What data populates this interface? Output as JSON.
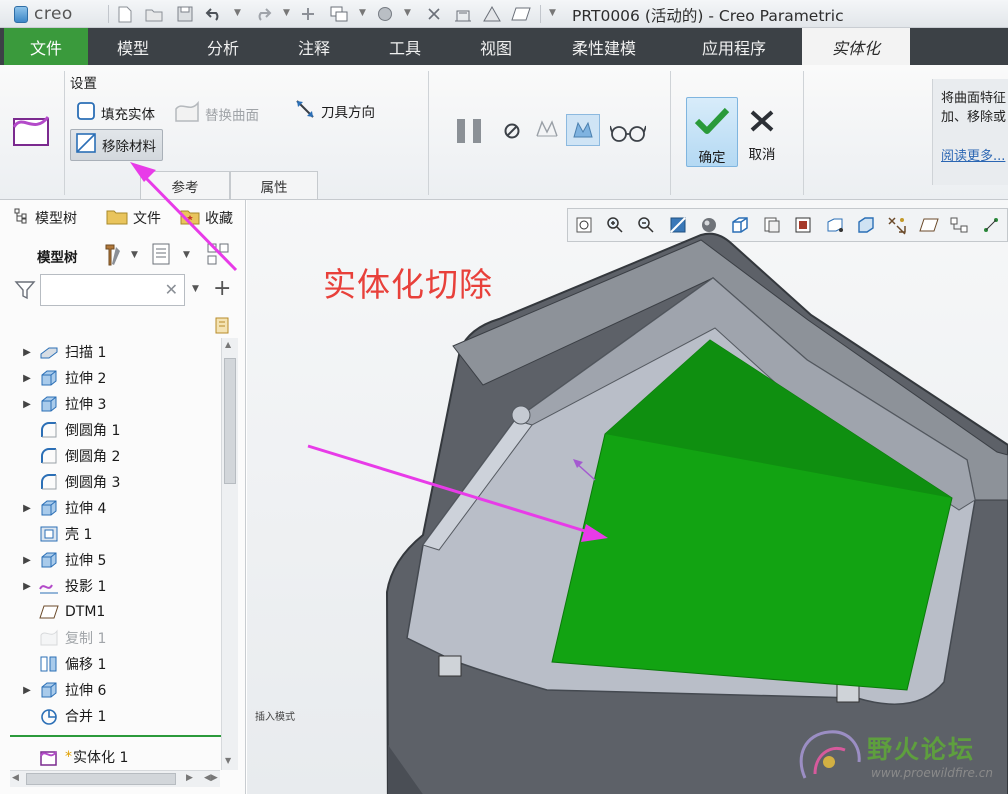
{
  "app": {
    "logo_text": "creo",
    "window_title": "PRT0006 (活动的) - Creo Parametric"
  },
  "tabs": [
    "文件",
    "模型",
    "分析",
    "注释",
    "工具",
    "视图",
    "柔性建模",
    "应用程序",
    "实体化"
  ],
  "active_tab": "实体化",
  "ribbon": {
    "settings_label": "设置",
    "fill_solid": "填充实体",
    "replace_surface": "替换曲面",
    "tool_direction": "刀具方向",
    "remove_material": "移除材料",
    "subtabs": [
      "参考",
      "属性"
    ],
    "ok": "确定",
    "cancel": "取消",
    "hint_line1": "将曲面特征",
    "hint_line2": "加、移除或",
    "hint_link": "阅读更多..."
  },
  "panel": {
    "tabs": [
      "模型树",
      "文件",
      "收藏"
    ],
    "tree_label": "模型树",
    "filter_placeholder": "",
    "items": [
      {
        "label": "扫描 1",
        "icon": "sweep-icon",
        "expandable": true,
        "dim": false
      },
      {
        "label": "拉伸 2",
        "icon": "extrude-icon",
        "expandable": true,
        "dim": false
      },
      {
        "label": "拉伸 3",
        "icon": "extrude-icon",
        "expandable": true,
        "dim": false
      },
      {
        "label": "倒圆角 1",
        "icon": "round-icon",
        "expandable": false,
        "dim": false
      },
      {
        "label": "倒圆角 2",
        "icon": "round-icon",
        "expandable": false,
        "dim": false
      },
      {
        "label": "倒圆角 3",
        "icon": "round-icon",
        "expandable": false,
        "dim": false
      },
      {
        "label": "拉伸 4",
        "icon": "extrude-icon",
        "expandable": true,
        "dim": false
      },
      {
        "label": "壳 1",
        "icon": "shell-icon",
        "expandable": false,
        "dim": false
      },
      {
        "label": "拉伸 5",
        "icon": "extrude-icon",
        "expandable": true,
        "dim": false
      },
      {
        "label": "投影 1",
        "icon": "project-icon",
        "expandable": true,
        "dim": false
      },
      {
        "label": "DTM1",
        "icon": "datum-plane-icon",
        "expandable": false,
        "dim": false
      },
      {
        "label": "复制 1",
        "icon": "copy-icon",
        "expandable": false,
        "dim": true
      },
      {
        "label": "偏移 1",
        "icon": "offset-icon",
        "expandable": false,
        "dim": false
      },
      {
        "label": "拉伸 6",
        "icon": "extrude-icon",
        "expandable": true,
        "dim": false
      },
      {
        "label": "合并 1",
        "icon": "merge-icon",
        "expandable": false,
        "dim": false
      }
    ],
    "current_feature_marker": "*",
    "current_feature": "实体化 1"
  },
  "graphics": {
    "annotation": "实体化切除",
    "insert_mode": "插入模式",
    "watermark_name": "野火论坛",
    "watermark_url": "www.proewildfire.cn"
  },
  "colors": {
    "file_tab": "#3a9a3c",
    "tabbar": "#3c4146",
    "annotation": "#e8403a",
    "arrow": "#e83be8",
    "cut_surface": "#12a312",
    "part_body": "#5d6168"
  }
}
